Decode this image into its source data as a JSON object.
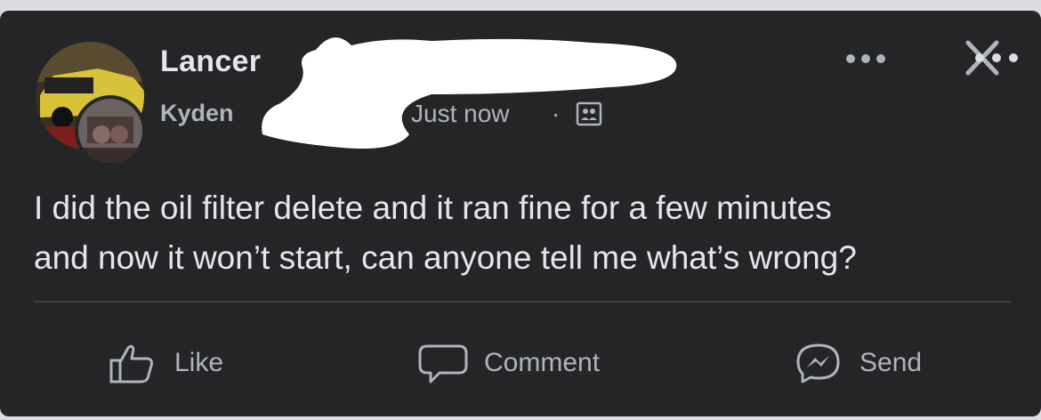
{
  "post": {
    "author_name": "Lancer",
    "group_name": "Kyden",
    "timestamp": "Just now",
    "separator": "·",
    "audience_icon": "group-audience-icon",
    "text_line1": "I did the oil filter delete and it ran fine for a few minutes",
    "text_line2": "and now it won’t start, can anyone tell me what’s wrong?"
  },
  "actions": {
    "like_label": "Like",
    "comment_label": "Comment",
    "send_label": "Send"
  },
  "icons": {
    "more": "more-options-icon",
    "close": "close-icon",
    "like": "thumbs-up-icon",
    "comment": "comment-bubble-icon",
    "send": "messenger-icon"
  },
  "colors": {
    "card_background": "#242526",
    "primary_text": "#e4e6eb",
    "secondary_text": "#b0b3b8",
    "redaction": "#ffffff"
  }
}
